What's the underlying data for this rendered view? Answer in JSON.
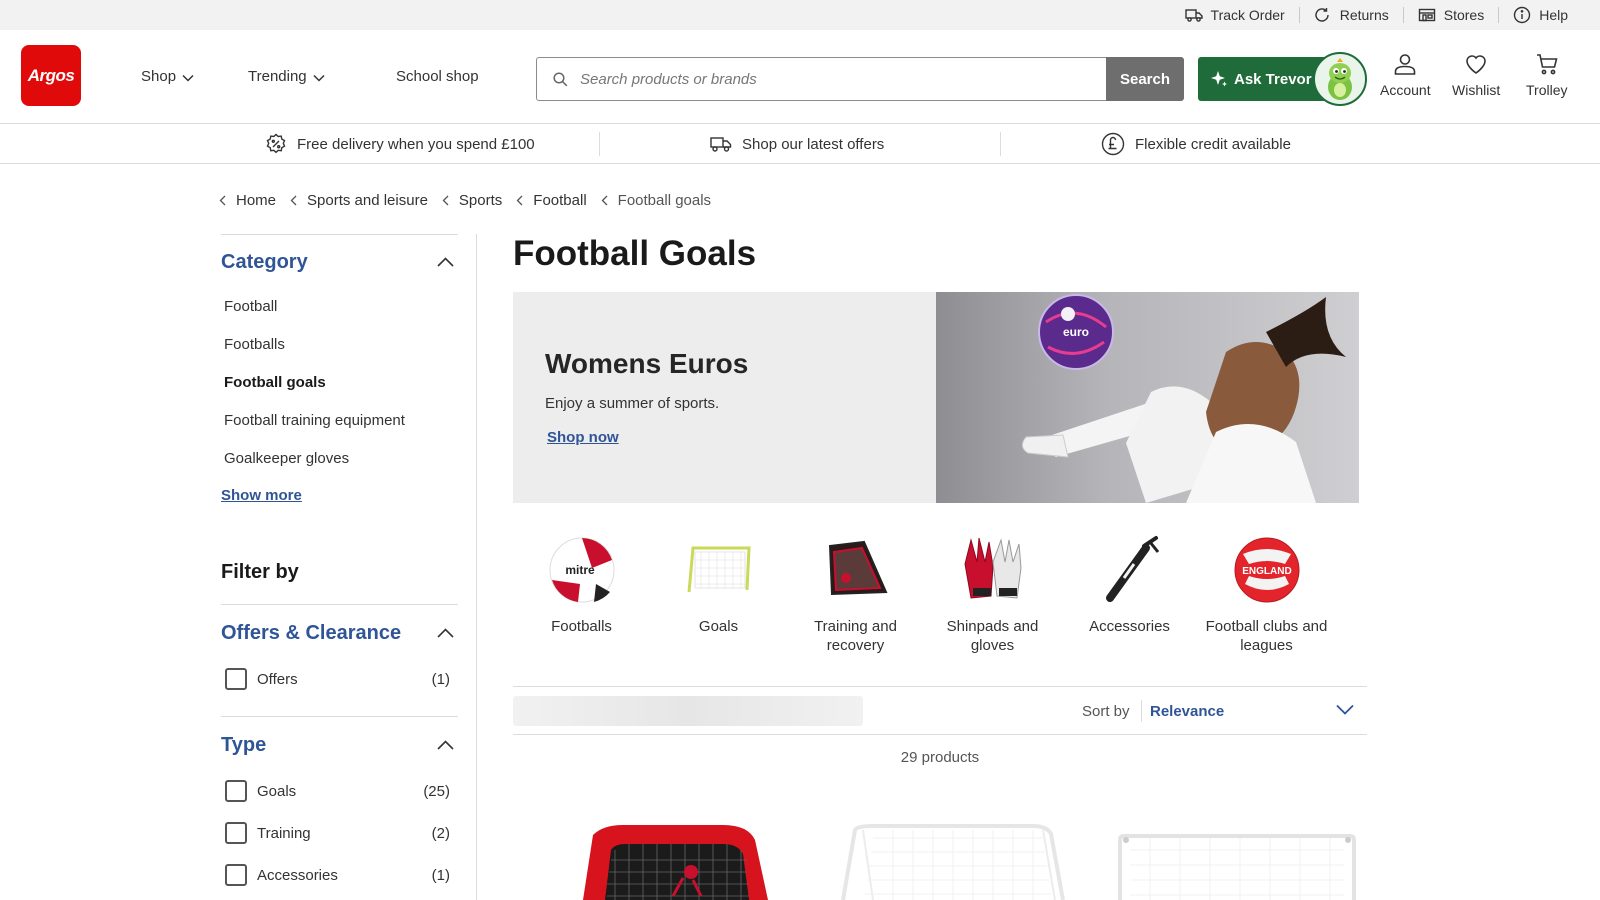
{
  "utility": {
    "links": [
      {
        "label": "Track Order",
        "icon": "truck-icon"
      },
      {
        "label": "Returns",
        "icon": "returns-icon"
      },
      {
        "label": "Stores",
        "icon": "store-icon"
      },
      {
        "label": "Help",
        "icon": "info-icon"
      }
    ]
  },
  "header": {
    "logo_text": "Argos",
    "nav": [
      {
        "label": "Shop",
        "has_dropdown": true
      },
      {
        "label": "Trending",
        "has_dropdown": true
      },
      {
        "label": "School shop",
        "has_dropdown": false
      }
    ],
    "search": {
      "placeholder": "Search products or brands",
      "value": "",
      "button_label": "Search"
    },
    "ask_trevor_label": "Ask Trevor",
    "actions": [
      {
        "label": "Account",
        "icon": "account-icon"
      },
      {
        "label": "Wishlist",
        "icon": "heart-icon"
      },
      {
        "label": "Trolley",
        "icon": "trolley-icon"
      }
    ],
    "brand_color": "#e10a0a",
    "trevor_color": "#1f6b3a"
  },
  "benefits": [
    {
      "label": "Free delivery when you spend £100",
      "icon": "percent-badge-icon"
    },
    {
      "label": "Shop our latest offers",
      "icon": "delivery-van-icon"
    },
    {
      "label": "Flexible credit available",
      "icon": "pound-icon"
    }
  ],
  "breadcrumb": [
    "Home",
    "Sports and leisure",
    "Sports",
    "Football",
    "Football goals"
  ],
  "sidebar": {
    "category_title": "Category",
    "categories": [
      {
        "label": "Football",
        "active": false
      },
      {
        "label": "Footballs",
        "active": false
      },
      {
        "label": "Football goals",
        "active": true
      },
      {
        "label": "Football training equipment",
        "active": false
      },
      {
        "label": "Goalkeeper gloves",
        "active": false
      }
    ],
    "show_more": "Show more",
    "filter_by": "Filter by",
    "offers": {
      "title": "Offers & Clearance",
      "options": [
        {
          "label": "Offers",
          "count": "(1)"
        }
      ]
    },
    "type": {
      "title": "Type",
      "options": [
        {
          "label": "Goals",
          "count": "(25)"
        },
        {
          "label": "Training",
          "count": "(2)"
        },
        {
          "label": "Accessories",
          "count": "(1)"
        }
      ]
    },
    "accent_color": "#2f5597"
  },
  "main": {
    "title": "Football Goals",
    "hero": {
      "title": "Womens Euros",
      "subtitle": "Enjoy a summer of sports.",
      "link": "Shop now",
      "ball_text": "euro"
    },
    "categories": [
      {
        "label": "Footballs",
        "icon": "football-mitre-icon",
        "ball_text": "mitre"
      },
      {
        "label": "Goals",
        "icon": "goal-icon"
      },
      {
        "label": "Training and recovery",
        "icon": "rebounder-icon"
      },
      {
        "label": "Shinpads and gloves",
        "icon": "goalkeeper-gloves-icon"
      },
      {
        "label": "Accessories",
        "icon": "ball-pump-icon"
      },
      {
        "label": "Football clubs and leagues",
        "icon": "england-football-icon",
        "ball_text": "ENGLAND"
      }
    ],
    "sort": {
      "label": "Sort by",
      "value": "Relevance"
    },
    "product_count": "29 products"
  }
}
